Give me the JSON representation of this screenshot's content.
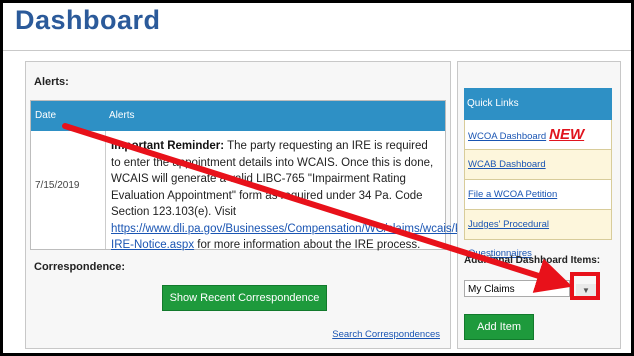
{
  "page": {
    "title": "Dashboard"
  },
  "alerts": {
    "section_label": "Alerts:",
    "columns": [
      "Date",
      "Alerts"
    ],
    "rows": [
      {
        "date": "7/15/2019",
        "reminder_label": "Important Reminder:",
        "message_1": " The party requesting an IRE is required to enter the appointment details into WCAIS.  Once this is done, WCAIS will generate a valid LIBC-765 \"Impairment Rating Evaluation Appointment\" form as required under 34 Pa. Code Section 123.103(e).  Visit ",
        "link": "https://www.dli.pa.gov/Businesses/Compensation/WC/claims/wcais/Pages/Important-IRE-Notice.aspx",
        "message_2": " for more information about the IRE process."
      }
    ]
  },
  "correspondence": {
    "section_label": "Correspondence:",
    "show_button": "Show Recent Correspondence",
    "search_link": "Search Correspondences"
  },
  "quick_links": {
    "header": "Quick Links",
    "items": [
      {
        "label": "WCOA Dashboard",
        "badge": "NEW"
      },
      {
        "label": "WCAB Dashboard"
      },
      {
        "label": "File a WCOA Petition"
      },
      {
        "label": "Judges' Procedural Questionnaires"
      }
    ]
  },
  "additional_items": {
    "label": "Additional Dashboard Items:",
    "selected": "My Claims",
    "add_button": "Add Item"
  },
  "annotation": {
    "color": "#e8111a"
  }
}
